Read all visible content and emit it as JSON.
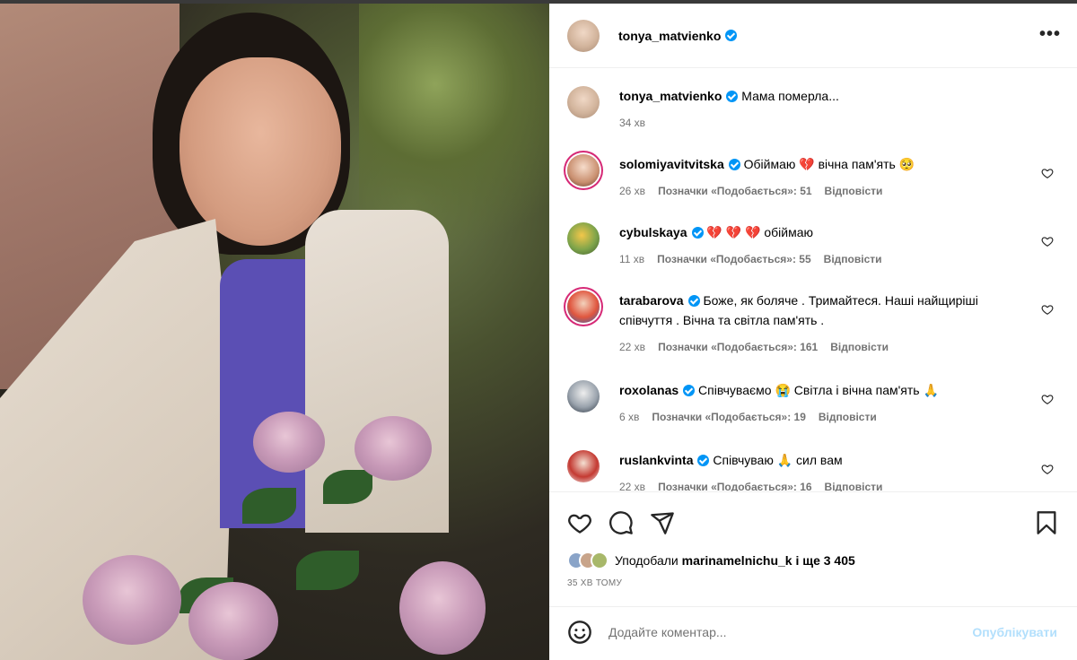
{
  "colors": {
    "accent": "#0095f6",
    "post_disabled": "#b2dffc",
    "heart_emoji": "#e0245e"
  },
  "post": {
    "author": "tonya_matvienko",
    "caption": "Мама померла...",
    "caption_time": "34 хв"
  },
  "comments": [
    {
      "user": "solomiyavitvitska",
      "text": "Обіймаю 💔 вічна пам'ять 🥺",
      "time": "26 хв",
      "likes": "Позначки «Подобається»: 51",
      "reply": "Відповісти"
    },
    {
      "user": "cybulskaya",
      "text": "💔 💔 💔 обіймаю",
      "time": "11 хв",
      "likes": "Позначки «Подобається»: 55",
      "reply": "Відповісти"
    },
    {
      "user": "tarabarova",
      "text": "Боже, як боляче . Тримайтеся. Наші найщиріші співчуття . Вічна та світла пам'ять .",
      "time": "22 хв",
      "likes": "Позначки «Подобається»: 161",
      "reply": "Відповісти"
    },
    {
      "user": "roxolanas",
      "text": "Співчуваємо 😭 Світла і вічна пам'ять 🙏",
      "time": "6 хв",
      "likes": "Позначки «Подобається»: 19",
      "reply": "Відповісти"
    },
    {
      "user": "ruslankvinta",
      "text": "Співчуваю 🙏 сил вам",
      "time": "22 хв",
      "likes": "Позначки «Подобається»: 16",
      "reply": "Відповісти"
    }
  ],
  "actions": {
    "liked_by_prefix": "Уподобали",
    "liked_by_user": "marinamelnichu_k",
    "liked_by_suffix": "і ще 3 405",
    "time_ago": "35 ХВ ТОМУ"
  },
  "add_comment": {
    "placeholder": "Додайте коментар...",
    "post_label": "Опублікувати"
  },
  "icons": [
    "verified-badge",
    "more-options-icon",
    "heart-icon",
    "comment-icon",
    "share-icon",
    "bookmark-icon",
    "emoji-icon"
  ]
}
